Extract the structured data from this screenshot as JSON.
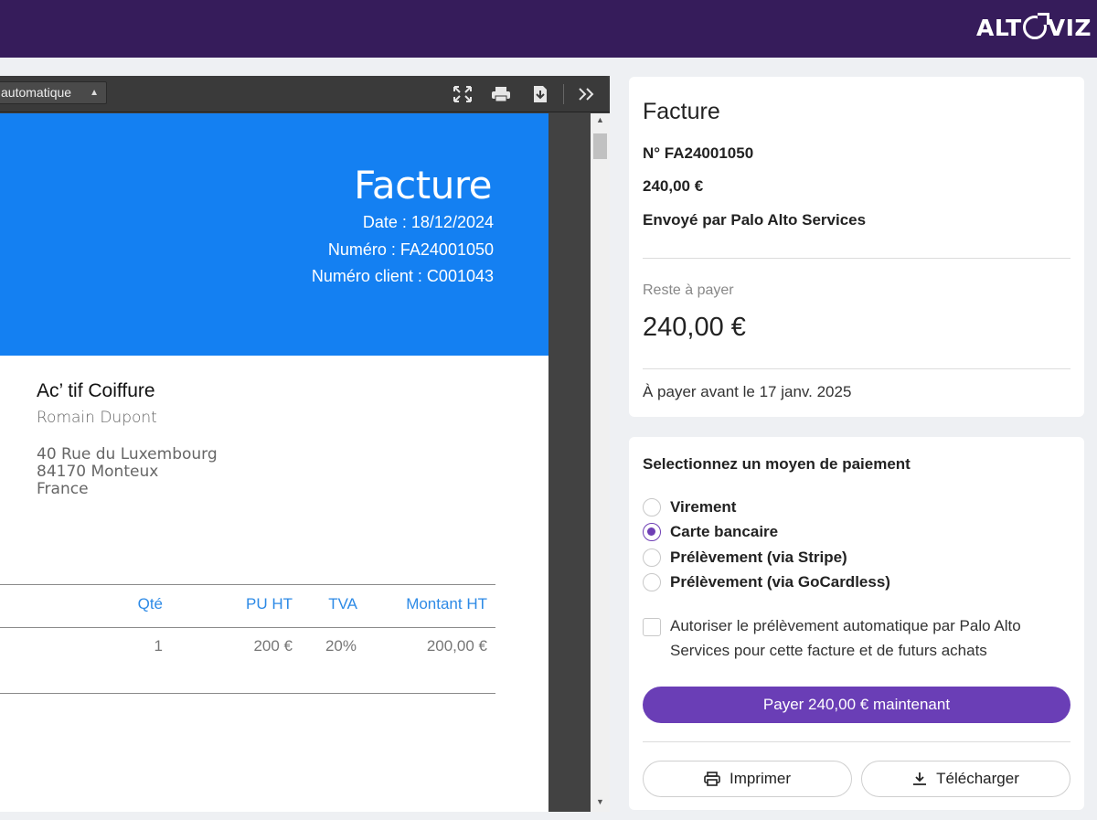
{
  "brand": {
    "logo_text": "ALTOVIZ"
  },
  "viewer": {
    "zoom_value": "automatique",
    "toolbar_icons": [
      "fullscreen-icon",
      "print-icon",
      "download-icon",
      "more-tools-icon"
    ]
  },
  "invoice": {
    "title": "Facture",
    "date": "Date : 18/12/2024",
    "number": "Numéro : FA24001050",
    "client_number": "Numéro client : C001043",
    "client_name": "Ac’ tif Coiffure",
    "client_contact": "Romain Dupont",
    "address": [
      "40 Rue du Luxembourg",
      "84170 Monteux",
      "France"
    ],
    "table": {
      "headers": {
        "qty": "Qté",
        "unit_price": "PU HT",
        "vat": "TVA",
        "amount": "Montant HT"
      },
      "rows": [
        {
          "qty": "1",
          "unit_price": "200 €",
          "vat": "20%",
          "amount": "200,00 €"
        }
      ]
    }
  },
  "summary": {
    "title": "Facture",
    "number": "N° FA24001050",
    "amount": "240,00 €",
    "sender": "Envoyé par Palo Alto Services",
    "remaining_label": "Reste à payer",
    "remaining_amount": "240,00 €",
    "due": "À payer avant le 17 janv. 2025"
  },
  "payment": {
    "title": "Selectionnez un moyen de paiement",
    "methods": [
      {
        "label": "Virement",
        "checked": false
      },
      {
        "label": "Carte bancaire",
        "checked": true
      },
      {
        "label": "Prélèvement  (via Stripe)",
        "checked": false
      },
      {
        "label": "Prélèvement  (via GoCardless)",
        "checked": false
      }
    ],
    "authorize_label": "Autoriser le prélèvement automatique par Palo Alto Services pour cette facture et de futurs achats",
    "pay_button": "Payer 240,00 € maintenant",
    "print_button": "Imprimer",
    "download_button": "Télécharger"
  },
  "colors": {
    "topbar": "#361c5b",
    "accent": "#6a3eb6",
    "invoice_blue": "#1480f2"
  }
}
